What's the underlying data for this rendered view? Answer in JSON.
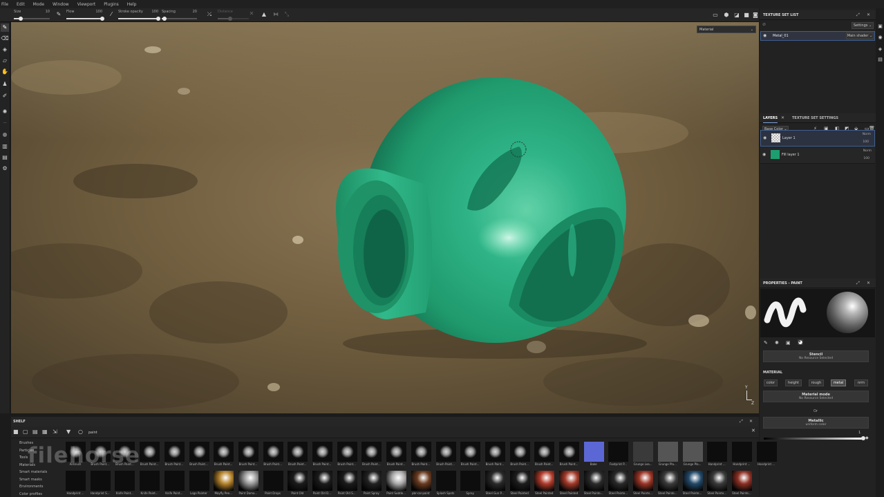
{
  "menu": [
    "File",
    "Edit",
    "Mode",
    "Window",
    "Viewport",
    "Plugins",
    "Help"
  ],
  "toolbar": {
    "size": {
      "label": "Size",
      "value": "10",
      "level": 0.2
    },
    "flow": {
      "label": "Flow",
      "value": "100",
      "level": 1.0
    },
    "stroke_opacity": {
      "label": "Stroke opacity",
      "value": "100",
      "level": 1.0
    },
    "spacing": {
      "label": "Spacing",
      "value": "20",
      "level": 0.08
    },
    "distance": {
      "label": "Distance",
      "value": "",
      "level": 0.4
    }
  },
  "viewport": {
    "mode_dropdown": "Material",
    "axis_y": "Y",
    "axis_z": "Z"
  },
  "texture_set_list": {
    "title": "TEXTURE SET LIST",
    "settings_btn": "Settings",
    "set_name": "Metal_01",
    "shader": "Main shader"
  },
  "layers": {
    "tab_layers": "LAYERS",
    "tab_settings": "TEXTURE SET SETTINGS",
    "channel": "Base Color",
    "items": [
      {
        "name": "Layer 1",
        "blend": "Norm",
        "opacity": "100"
      },
      {
        "name": "Fill layer 1",
        "blend": "Norm",
        "opacity": "100"
      }
    ]
  },
  "properties": {
    "title": "PROPERTIES - PAINT",
    "stencil_label": "Stencil",
    "stencil_value": "No Resource Selected",
    "material_header": "MATERIAL",
    "chips": [
      "color",
      "height",
      "rough",
      "metal",
      "nrm"
    ],
    "active_chip": "metal",
    "material_mode_label": "Material mode",
    "material_mode_value": "No Resource Selected",
    "or_label": "Or",
    "metallic_label": "Metallic",
    "metallic_value": "uniform color",
    "metallic_slider_value": "1",
    "metallic_level": 1.0
  },
  "shelf": {
    "title": "SHELF",
    "search": "paint",
    "categories": [
      "Brushes",
      "Particles",
      "Tools",
      "Materials",
      "Smart materials",
      "Smart masks",
      "Environments",
      "Color profiles"
    ],
    "row1": [
      "Airbrush",
      "Brush Paint...",
      "Brush Paint...",
      "Brush Paint...",
      "Brush Paint...",
      "Brush Paint...",
      "Brush Paint...",
      "Brush Paint...",
      "Brush Paint...",
      "Brush Paint...",
      "Brush Paint...",
      "Brush Paint...",
      "Brush Paint...",
      "Brush Paint...",
      "Brush Paint...",
      "Brush Paint...",
      "Brush Paint...",
      "Brush Paint...",
      "Brush Paint...",
      "Brush Paint...",
      "Brush Paint...",
      "Bake",
      "Footprint P...",
      "Grunge Lea...",
      "Grunge Pla...",
      "Grunge Pla...",
      "Handprint ...",
      "Handprint ...",
      "Handprint ..."
    ],
    "row2": [
      "Handprint ...",
      "Handprint S...",
      "Knife Paint...",
      "Knife Paint...",
      "Knife Paint...",
      "Logo Painter",
      "Mayfly Pee...",
      "Paint Dama...",
      "Paint Drops",
      "Paint Old",
      "Paint Old D...",
      "Paint Old S...",
      "Paint Spray",
      "Paint Subtle...",
      "pbr-car-paint",
      "Splash Spots",
      "Spray",
      "Steel Gun P...",
      "Steel Painted",
      "Steel Painted",
      "Steel Painted",
      "Steel Painte...",
      "Steel Painte...",
      "Steel Painte...",
      "Steel Painte...",
      "Steel Painte...",
      "Steel Painte...",
      "Steel Painte..."
    ]
  },
  "watermark": "filehorse"
}
